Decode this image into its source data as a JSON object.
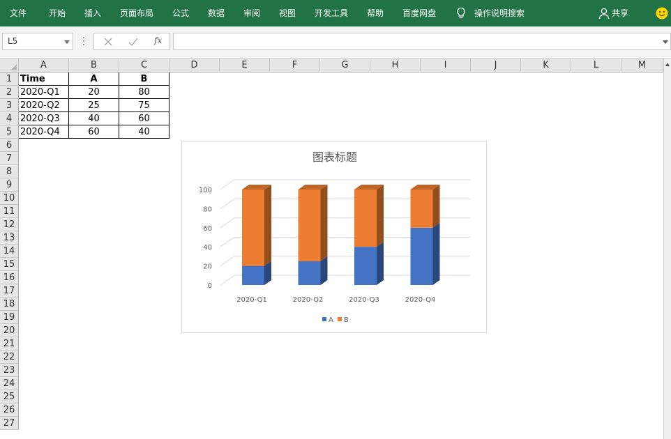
{
  "ribbon": {
    "tabs": [
      "文件",
      "开始",
      "插入",
      "页面布局",
      "公式",
      "数据",
      "审阅",
      "视图",
      "开发工具",
      "帮助",
      "百度网盘"
    ],
    "search_label": "操作说明搜索",
    "share_label": "共享"
  },
  "formula_bar": {
    "name_box": "L5",
    "fx_label": "fx",
    "formula": ""
  },
  "columns": [
    "A",
    "B",
    "C",
    "D",
    "E",
    "F",
    "G",
    "H",
    "I",
    "J",
    "K",
    "L",
    "M"
  ],
  "rows": [
    "1",
    "2",
    "3",
    "4",
    "5",
    "6",
    "7",
    "8",
    "9",
    "10",
    "11",
    "12",
    "13",
    "14",
    "15",
    "16",
    "17",
    "18",
    "19",
    "20",
    "21",
    "22",
    "23",
    "24",
    "25",
    "26",
    "27"
  ],
  "sheet": {
    "header": [
      "Time",
      "A",
      "B"
    ],
    "rows": [
      [
        "2020-Q1",
        "20",
        "80"
      ],
      [
        "2020-Q2",
        "25",
        "75"
      ],
      [
        "2020-Q3",
        "40",
        "60"
      ],
      [
        "2020-Q4",
        "60",
        "40"
      ]
    ]
  },
  "chart_data": {
    "type": "bar",
    "stacked": true,
    "style": "3d-column",
    "title": "图表标题",
    "categories": [
      "2020-Q1",
      "2020-Q2",
      "2020-Q3",
      "2020-Q4"
    ],
    "series": [
      {
        "name": "A",
        "values": [
          20,
          25,
          40,
          60
        ],
        "color": "#4472c4"
      },
      {
        "name": "B",
        "values": [
          80,
          75,
          60,
          40
        ],
        "color": "#ed7d31"
      }
    ],
    "yticks": [
      "0",
      "20",
      "40",
      "60",
      "80",
      "100"
    ],
    "ylim": [
      0,
      100
    ],
    "grid": true,
    "legend": "bottom"
  },
  "colors": {
    "ribbon": "#217346",
    "series_a": "#4472c4",
    "series_b": "#ed7d31"
  }
}
